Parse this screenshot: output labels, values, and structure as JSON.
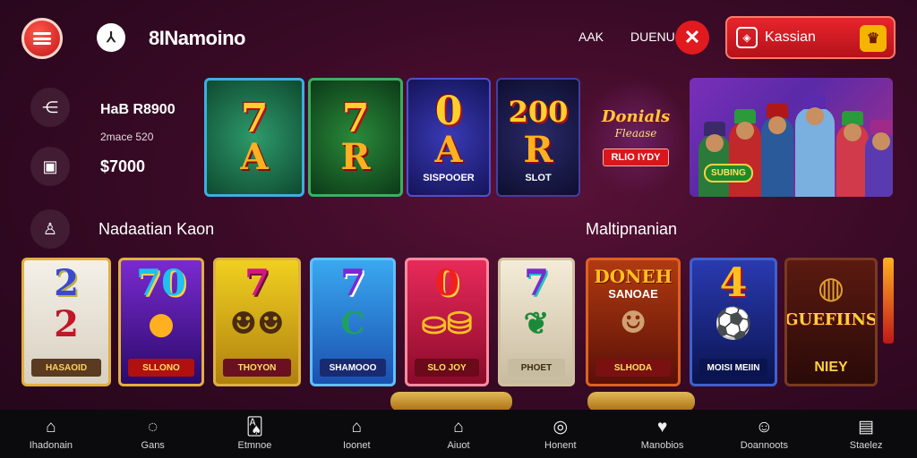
{
  "header": {
    "brand": "8INamoino",
    "nav_links": [
      "AAK",
      "DUENU"
    ],
    "action_label": "Kassian"
  },
  "sidebar": {
    "stat1": "HaB R8900",
    "stat2": "2mace 520",
    "stat3": "$7000"
  },
  "top_banner": {
    "tiles": [
      {
        "top": "7",
        "bottom": "A",
        "label": ""
      },
      {
        "top": "7",
        "bottom": "R",
        "label": ""
      },
      {
        "top": "0",
        "bottom": "A",
        "label": "SISPOOER"
      },
      {
        "top": "200",
        "bottom": "R",
        "label": "SLOT"
      }
    ],
    "promo_title": "Donials",
    "promo_sub": "Fleaase",
    "promo_button": "RLIO IYDY",
    "people_badge": "SUBING"
  },
  "sections": {
    "left_title": "Nadaatian Kaon",
    "right_title": "Maltipnanian"
  },
  "slots": [
    {
      "top": "2",
      "mid": "",
      "bottom": "2",
      "label": "HASAOID"
    },
    {
      "top": "70",
      "mid": "",
      "bottom": "",
      "label": "SLLONO"
    },
    {
      "top": "7",
      "mid": "",
      "bottom": "",
      "label": "THOYON"
    },
    {
      "top": "7",
      "mid": "C",
      "bottom": "",
      "label": "SHAMOOO"
    },
    {
      "top": "0",
      "mid": "",
      "bottom": "",
      "label": "SLO JOY"
    },
    {
      "top": "7",
      "mid": "",
      "bottom": "",
      "label": "PHOET"
    },
    {
      "top": "DONEH",
      "mid": "SANOAE",
      "bottom": "",
      "label": "SLHODA"
    },
    {
      "top": "4",
      "mid": "",
      "bottom": "",
      "label": "MOISI MEIIN"
    },
    {
      "top": "GUEFIINS",
      "mid": "",
      "bottom": "",
      "label": "NIEY"
    }
  ],
  "bottom_nav": [
    {
      "icon": "home-icon",
      "label": "Ihadonain"
    },
    {
      "icon": "chat-icon",
      "label": "Gans"
    },
    {
      "icon": "cards-icon",
      "label": "Etmnoe"
    },
    {
      "icon": "graduation-icon",
      "label": "Ioonet"
    },
    {
      "icon": "house-icon",
      "label": "Aiuot"
    },
    {
      "icon": "search-icon",
      "label": "Honent"
    },
    {
      "icon": "heart-icon",
      "label": "Manobios"
    },
    {
      "icon": "users-icon",
      "label": "Doannoots"
    },
    {
      "icon": "document-icon",
      "label": "Staelez"
    }
  ],
  "colors": {
    "background": "#3a0a26",
    "accent_red": "#e01a1f",
    "gold": "#ffcf2e",
    "nav_bg": "#0b0b0d"
  }
}
